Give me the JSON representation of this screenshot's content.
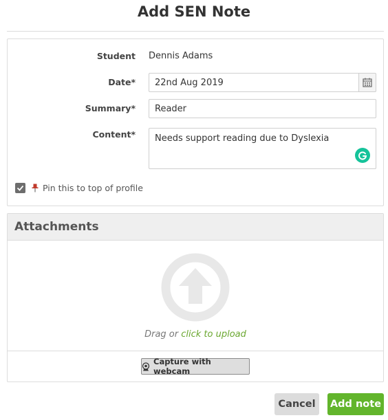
{
  "dialog": {
    "title": "Add SEN Note"
  },
  "form": {
    "student": {
      "label": "Student",
      "value": "Dennis Adams"
    },
    "date": {
      "label": "Date*",
      "value": "22nd Aug 2019"
    },
    "summary": {
      "label": "Summary*",
      "value": "Reader"
    },
    "content": {
      "label": "Content*",
      "value": "Needs support reading due to Dyslexia"
    },
    "pin": {
      "label": "Pin this to top of profile",
      "checked": true
    }
  },
  "attachments": {
    "title": "Attachments",
    "drag_text": "Drag or",
    "click_link": "click to upload",
    "webcam_label": "Capture with webcam"
  },
  "actions": {
    "cancel_label": "Cancel",
    "add_label": "Add note"
  },
  "colors": {
    "accent_green": "#62b52c",
    "link_green": "#6aa72f",
    "grammarly": "#15c39a",
    "pin_red": "#c0392b"
  },
  "icons": [
    "calendar-icon",
    "grammarly-icon",
    "checkmark-icon",
    "pin-icon",
    "upload-icon",
    "webcam-icon"
  ]
}
